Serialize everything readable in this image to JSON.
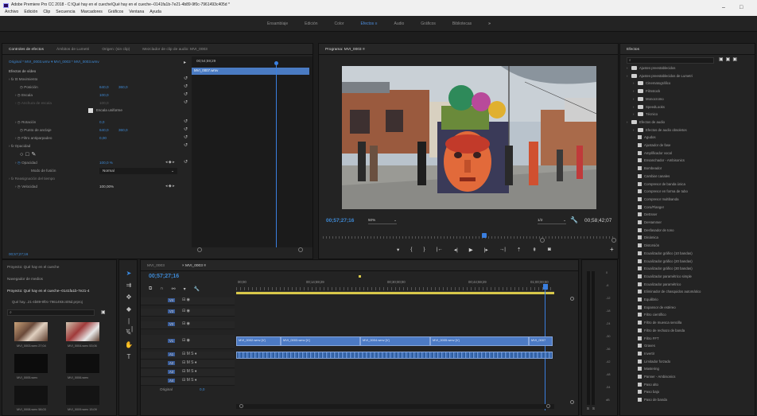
{
  "window": {
    "title": "Adobe Premiere Pro CC 2018 - C:\\Qué hay en el cueche\\Qué hay en el cueche--0141fa1b-7e21-4b89-9f0c-7961493c405d *",
    "minimize": "–",
    "maximize": "□"
  },
  "menu": [
    "Archivo",
    "Edición",
    "Clip",
    "Secuencia",
    "Marcadores",
    "Gráficos",
    "Ventana",
    "Ayuda"
  ],
  "workspaces": {
    "items": [
      "Ensamblaje",
      "Edición",
      "Color",
      "Efectos",
      "Audio",
      "Gráficos",
      "Bibliotecas"
    ],
    "active": "Efectos",
    "more": "»"
  },
  "effect_controls": {
    "tabs": [
      "Controles de efectos",
      "Ámbitos de Lumetri",
      "Origen: (sin clip)",
      "Mezclador de clip de audio: MVI_0003"
    ],
    "active_tab": "Controles de efectos",
    "source_row": "Original * MVI_0003.wmv  ▾  MVI_0003 * MVI_0003.wmv",
    "clip_name": "MVI_0007.wmv",
    "timecode": "00;54;59;29",
    "section_video": "Efectos de vídeo",
    "movimiento": "Movimiento",
    "posicion_label": "Posición",
    "posicion_x": "640,0",
    "posicion_y": "360,0",
    "escala_label": "Escala",
    "escala_val": "100,0",
    "anchura_label": "Anchura de escala",
    "anchura_val": "100,0",
    "escala_uniforme": "Escala uniforme",
    "rotacion_label": "Rotación",
    "rotacion_val": "0,0",
    "anclaje_label": "Punto de anclaje",
    "anclaje_x": "640,0",
    "anclaje_y": "360,0",
    "filtro_label": "Filtro antiparpadeo",
    "filtro_val": "0,00",
    "opacidad": "Opacidad",
    "opacidad_label": "Opacidad",
    "opacidad_val": "100,0 %",
    "fusion_label": "Modo de fusión",
    "fusion_val": "Normal",
    "reasignacion": "Reasignación del tiempo",
    "velocidad_label": "Velocidad",
    "velocidad_val": "100,00%",
    "footer_timecode": "00;57;27;16"
  },
  "program": {
    "tab": "Programa: MVI_0003",
    "timecode": "00;57;27;16",
    "zoom": "50%",
    "resolution": "1/2",
    "duration": "00;58;42;07"
  },
  "effects_panel": {
    "tab": "Efectos",
    "search_placeholder": "",
    "items": [
      {
        "label": "Ajustes preestablecidos",
        "type": "folder",
        "indent": 0
      },
      {
        "label": "Ajustes preestablecidos de Lumetri",
        "type": "folder",
        "indent": 0
      },
      {
        "label": "Cinematográfico",
        "type": "folder",
        "indent": 1
      },
      {
        "label": "Filmstock",
        "type": "folder",
        "indent": 1
      },
      {
        "label": "Monocromo",
        "type": "folder",
        "indent": 1
      },
      {
        "label": "SpeedLooks",
        "type": "folder",
        "indent": 1
      },
      {
        "label": "Técnico",
        "type": "folder",
        "indent": 1
      },
      {
        "label": "Efectos de audio",
        "type": "folder",
        "indent": 0
      },
      {
        "label": "Efectos de audio obsoletos",
        "type": "folder",
        "indent": 1
      },
      {
        "label": "Agudos",
        "type": "fx",
        "indent": 1
      },
      {
        "label": "Ajustador de fase",
        "type": "fx",
        "indent": 1
      },
      {
        "label": "Amplificador vocal",
        "type": "fx",
        "indent": 1
      },
      {
        "label": "Ensanchador - Ambisonics",
        "type": "fx",
        "indent": 1
      },
      {
        "label": "Bombeador",
        "type": "fx",
        "indent": 1
      },
      {
        "label": "Cambiar canales",
        "type": "fx",
        "indent": 1
      },
      {
        "label": "Compresor de banda única",
        "type": "fx",
        "indent": 1
      },
      {
        "label": "Compresor en forma de tubo",
        "type": "fx",
        "indent": 1
      },
      {
        "label": "Compresor multibanda",
        "type": "fx",
        "indent": 1
      },
      {
        "label": "Coro/Flanger",
        "type": "fx",
        "indent": 1
      },
      {
        "label": "DeEsser",
        "type": "fx",
        "indent": 1
      },
      {
        "label": "DeHammer",
        "type": "fx",
        "indent": 1
      },
      {
        "label": "Desfasador de tono",
        "type": "fx",
        "indent": 1
      },
      {
        "label": "Dinámica",
        "type": "fx",
        "indent": 1
      },
      {
        "label": "Distorsión",
        "type": "fx",
        "indent": 1
      },
      {
        "label": "Ecualizador gráfico (10 bandas)",
        "type": "fx",
        "indent": 1
      },
      {
        "label": "Ecualizador gráfico (20 bandas)",
        "type": "fx",
        "indent": 1
      },
      {
        "label": "Ecualizador gráfico (30 bandas)",
        "type": "fx",
        "indent": 1
      },
      {
        "label": "Ecualizador paramétrico simple",
        "type": "fx",
        "indent": 1
      },
      {
        "label": "Ecualizador paramétrico",
        "type": "fx",
        "indent": 1
      },
      {
        "label": "Eliminador de chasquidos automático",
        "type": "fx",
        "indent": 1
      },
      {
        "label": "Equilibrio",
        "type": "fx",
        "indent": 1
      },
      {
        "label": "Expansor de estéreo",
        "type": "fx",
        "indent": 1
      },
      {
        "label": "Filtro científico",
        "type": "fx",
        "indent": 1
      },
      {
        "label": "Filtro de muesca sencilla",
        "type": "fx",
        "indent": 1
      },
      {
        "label": "Filtro de rechazo de banda",
        "type": "fx",
        "indent": 1
      },
      {
        "label": "Filtro FFT",
        "type": "fx",
        "indent": 1
      },
      {
        "label": "Graves",
        "type": "fx",
        "indent": 1
      },
      {
        "label": "Invertir",
        "type": "fx",
        "indent": 1
      },
      {
        "label": "Limitador forzado",
        "type": "fx",
        "indent": 1
      },
      {
        "label": "Mastering",
        "type": "fx",
        "indent": 1
      },
      {
        "label": "Panner - Ambisonics",
        "type": "fx",
        "indent": 1
      },
      {
        "label": "Paso alto",
        "type": "fx",
        "indent": 1
      },
      {
        "label": "Paso bajo",
        "type": "fx",
        "indent": 1
      },
      {
        "label": "Paso de banda",
        "type": "fx",
        "indent": 1
      }
    ]
  },
  "project": {
    "tabs": [
      "Proyecto: Qué hay en el cueche",
      "Navegador de medios",
      "Proyecto: Qué hay en el cueche--0141fa1b-7e21-4"
    ],
    "file": "Qué hay...21-4b89-9f0c-7961493c405d.prproj",
    "items": [
      {
        "name": "MVI_0003.wmv",
        "dur": "27;04"
      },
      {
        "name": "MVI_0004.wmv",
        "dur": "53;06"
      },
      {
        "name": "MVI_0005.wmv",
        "dur": ""
      },
      {
        "name": "MVI_0006.wmv",
        "dur": ""
      },
      {
        "name": "MVI_0008.wmv",
        "dur": "58;03"
      },
      {
        "name": "MVI_0009.wmv",
        "dur": "15;09"
      }
    ]
  },
  "timeline": {
    "tabs": [
      "MVI_0003",
      "MVI_0003"
    ],
    "active_tab_index": 1,
    "timecode": "00;57;27;16",
    "ruler": [
      "00;00",
      "00;14;59;29",
      "00;30;00;00",
      "00;44;59;29",
      "01;00;00;00"
    ],
    "video_tracks": [
      "V4",
      "V3",
      "V2",
      "V1"
    ],
    "audio_tracks": [
      "A1",
      "A2",
      "A3",
      "A4"
    ],
    "original_label": "Original",
    "original_val": "0,0",
    "clips": [
      "MVI_0002.wmv [V]",
      "MVI_0003.wmv [V]",
      "MVI_0004.wmv [V]",
      "MVI_0005.wmv [V]",
      "MVI_0007"
    ],
    "tool_icons": [
      "selection-icon",
      "track-select-icon",
      "ripple-edit-icon",
      "razor-icon",
      "slip-icon",
      "pen-icon",
      "hand-icon",
      "type-icon"
    ]
  },
  "meter": {
    "scale": [
      "0",
      "-6",
      "-12",
      "-18",
      "-24",
      "-30",
      "-36",
      "-42",
      "-48",
      "-54",
      "dB"
    ],
    "solo": "S"
  },
  "colors": {
    "accent_blue": "#3e8ad6",
    "clip_blue": "#4c7ac4",
    "playhead": "#3a7fe0",
    "panel_bg": "#232323"
  }
}
